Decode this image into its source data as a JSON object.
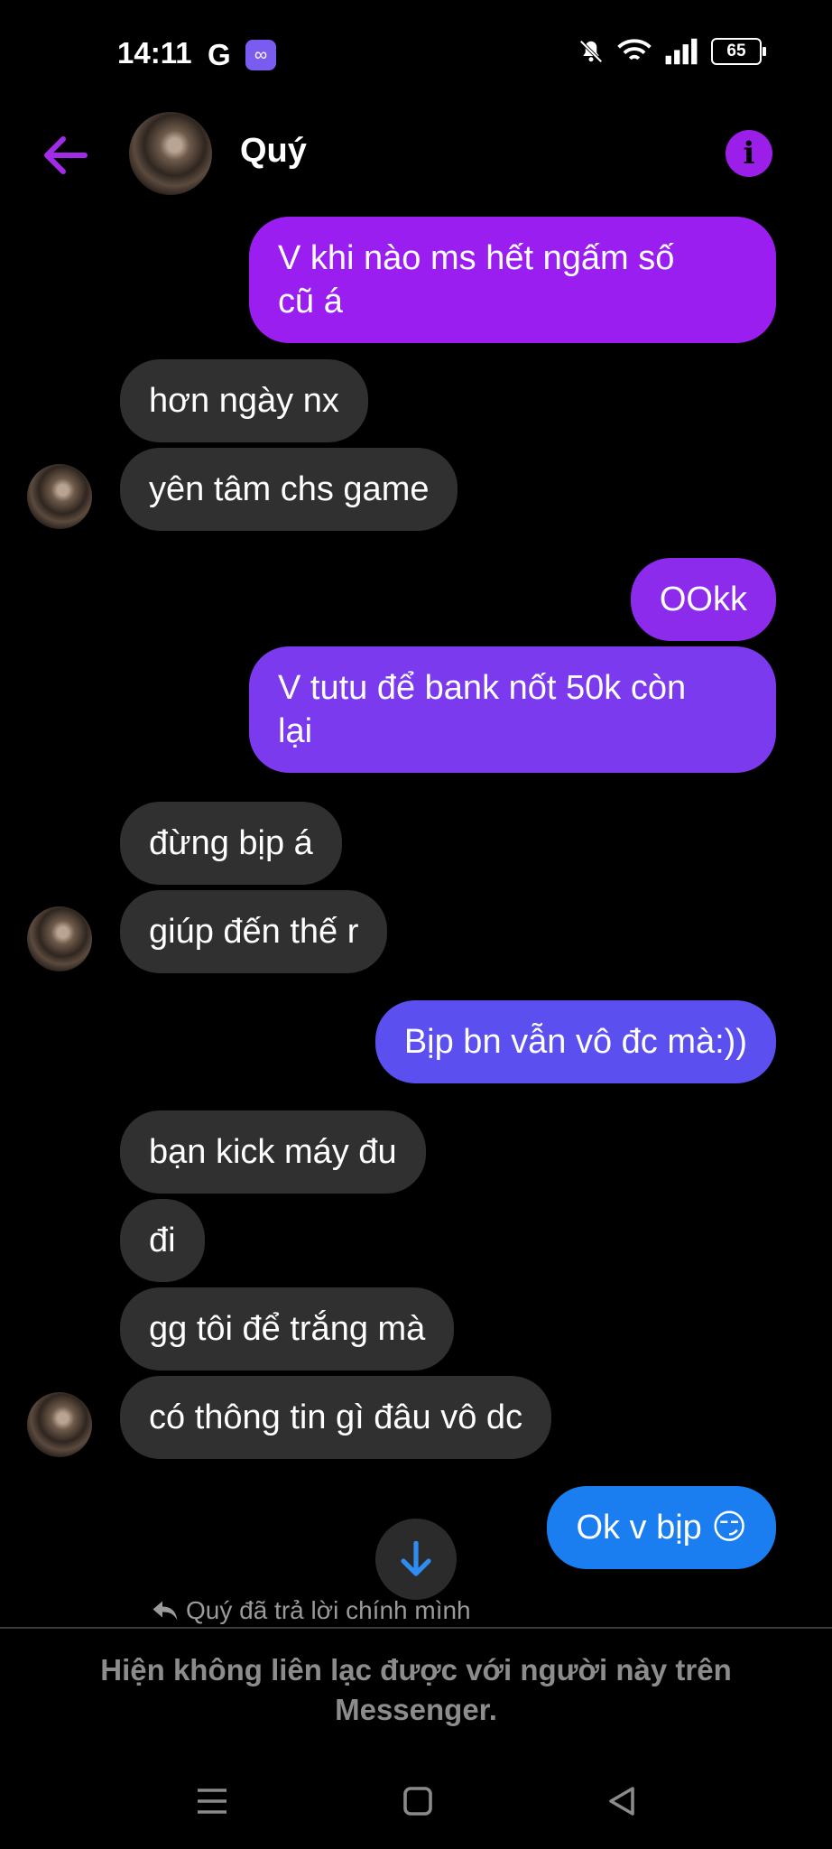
{
  "status": {
    "time": "14:11",
    "g_label": "G",
    "battery": "65"
  },
  "header": {
    "name": "Quý"
  },
  "messages": [
    {
      "side": "out",
      "text_line1": "V khi nào ms hết ngấm số",
      "text_line2": "cũ á"
    },
    {
      "side": "in",
      "text": "hơn ngày nx"
    },
    {
      "side": "in",
      "text": "yên tâm chs game"
    },
    {
      "side": "out",
      "text": "OOkk"
    },
    {
      "side": "out",
      "text_line1": "V tutu để bank nốt 50k còn",
      "text_line2": "lại"
    },
    {
      "side": "in",
      "text": "đừng bịp á"
    },
    {
      "side": "in",
      "text": "giúp đến thế r"
    },
    {
      "side": "out",
      "text": "Bịp bn vẫn vô đc mà:))"
    },
    {
      "side": "in",
      "text": "bạn kick máy đu"
    },
    {
      "side": "in",
      "text": "đi"
    },
    {
      "side": "in",
      "text": "gg tôi để trắng mà"
    },
    {
      "side": "in",
      "text": "có thông tin gì đâu vô dc"
    },
    {
      "side": "out",
      "text": "Ok v bịp 😏"
    }
  ],
  "reply_note": "Quý đã trả lời chính mình",
  "notice": {
    "line1": "Hiện không liên lạc được với người này trên",
    "line2": "Messenger."
  },
  "colors": {
    "purple_top": "#9b1ef0",
    "purple_mid": "#7c3aee",
    "blue_violet": "#5b4ff0",
    "blue": "#1a7ef0",
    "accent": "#a12be6"
  },
  "icons": [
    "back-arrow-icon",
    "info-icon",
    "arrow-down-icon",
    "reply-icon",
    "mute-icon",
    "wifi-icon",
    "signal-icon",
    "battery-icon",
    "menu-icon",
    "home-icon",
    "back-nav-icon"
  ]
}
